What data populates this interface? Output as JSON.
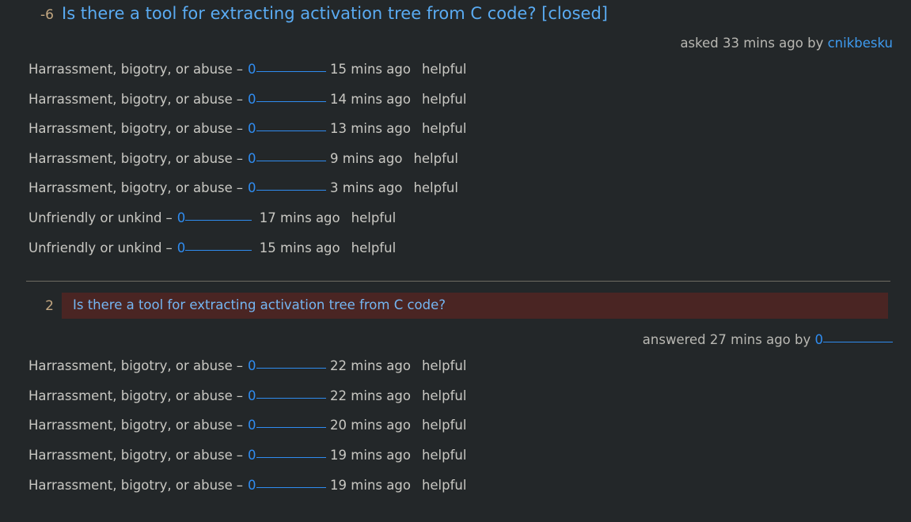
{
  "theme": {
    "background": "#232729",
    "text": "#c9c8c3",
    "link": "#5aabf2",
    "score_color": "#c4a882",
    "highlight_background": "#4a2523",
    "divider": "#6f6c63",
    "redacted_link": "#2f8cf0"
  },
  "question": {
    "score": "-6",
    "title": "Is there a tool for extracting activation tree from C code? [closed]",
    "byline_prefix": "asked 33 mins ago by",
    "byline_user": "cnikbesku",
    "flags": [
      {
        "reason": "Harrassment, bigotry, or abuse",
        "dash": "–",
        "user": "0",
        "time": "15 mins ago",
        "action": "helpful"
      },
      {
        "reason": "Harrassment, bigotry, or abuse",
        "dash": "–",
        "user": "0",
        "time": "14 mins ago",
        "action": "helpful"
      },
      {
        "reason": "Harrassment, bigotry, or abuse",
        "dash": "–",
        "user": "0",
        "time": "13 mins ago",
        "action": "helpful"
      },
      {
        "reason": "Harrassment, bigotry, or abuse",
        "dash": "–",
        "user": "0",
        "time": "9 mins ago",
        "action": "helpful"
      },
      {
        "reason": "Harrassment, bigotry, or abuse",
        "dash": "–",
        "user": "0",
        "time": "3 mins ago",
        "action": "helpful"
      },
      {
        "reason": "Unfriendly or unkind",
        "dash": "–",
        "user": "0",
        "time": "17 mins ago",
        "action": "helpful"
      },
      {
        "reason": "Unfriendly or unkind",
        "dash": "–",
        "user": "0",
        "time": "15 mins ago",
        "action": "helpful"
      }
    ]
  },
  "answer": {
    "score": "2",
    "title": "Is there a tool for extracting activation tree from C code?",
    "byline_prefix": "answered 27 mins ago by",
    "byline_user": "0",
    "flags": [
      {
        "reason": "Harrassment, bigotry, or abuse",
        "dash": "–",
        "user": "0",
        "time": "22 mins ago",
        "action": "helpful"
      },
      {
        "reason": "Harrassment, bigotry, or abuse",
        "dash": "–",
        "user": "0",
        "time": "22 mins ago",
        "action": "helpful"
      },
      {
        "reason": "Harrassment, bigotry, or abuse",
        "dash": "–",
        "user": "0",
        "time": "20 mins ago",
        "action": "helpful"
      },
      {
        "reason": "Harrassment, bigotry, or abuse",
        "dash": "–",
        "user": "0",
        "time": "19 mins ago",
        "action": "helpful"
      },
      {
        "reason": "Harrassment, bigotry, or abuse",
        "dash": "–",
        "user": "0",
        "time": "19 mins ago",
        "action": "helpful"
      }
    ]
  }
}
